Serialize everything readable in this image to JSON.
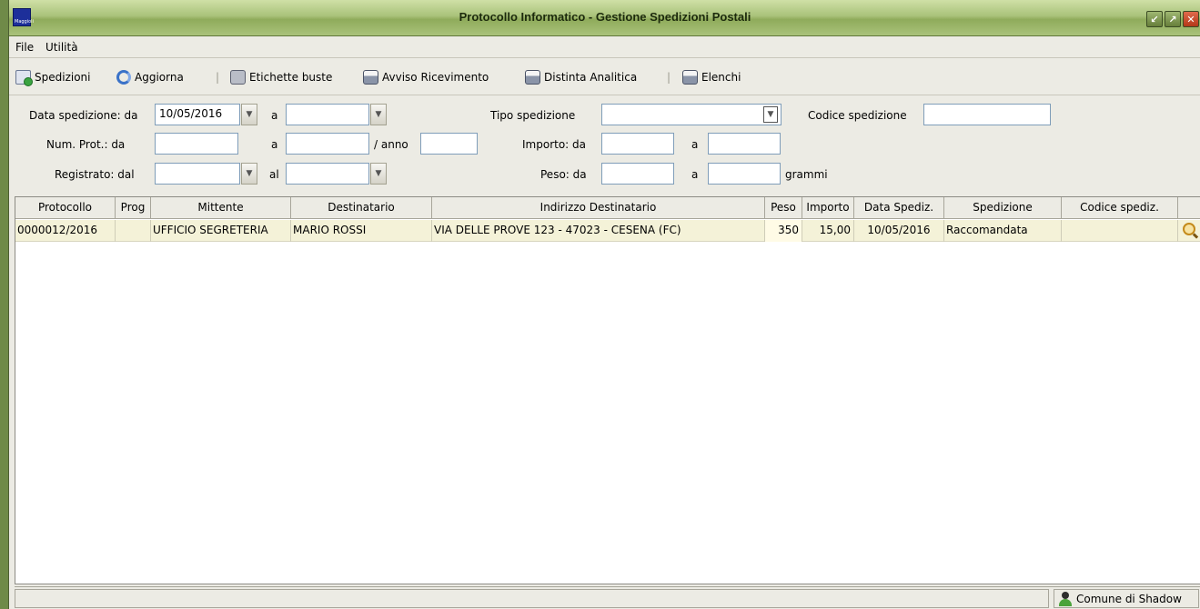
{
  "window": {
    "title": "Protocollo Informatico - Gestione Spedizioni Postali",
    "logo_text": "Maggioli"
  },
  "menu": [
    "File",
    "Utilità"
  ],
  "toolbar": {
    "spedizioni": "Spedizioni",
    "aggiorna": "Aggiorna",
    "etichette": "Etichette buste",
    "avviso": "Avviso Ricevimento",
    "distinta": "Distinta Analitica",
    "elenchi": "Elenchi"
  },
  "filters": {
    "data_spedizione_label": "Data spedizione: da",
    "data_spedizione_da": "10/05/2016",
    "a1": "a",
    "data_spedizione_a": "",
    "tipo_spedizione_label": "Tipo spedizione",
    "tipo_spedizione_value": "",
    "codice_spedizione_label": "Codice spedizione",
    "codice_spedizione_value": "",
    "num_prot_label": "Num. Prot.: da",
    "num_prot_da": "",
    "a2": "a",
    "num_prot_a": "",
    "anno_label": "/ anno",
    "anno_value": "",
    "importo_label": "Importo: da",
    "importo_da": "",
    "a3": "a",
    "importo_a": "",
    "registrato_label": "Registrato: dal",
    "registrato_dal": "",
    "al_label": "al",
    "registrato_al": "",
    "peso_label": "Peso: da",
    "peso_da": "",
    "a4": "a",
    "peso_a": "",
    "grammi_label": "grammi"
  },
  "table": {
    "headers": [
      "Protocollo",
      "Prog",
      "Mittente",
      "Destinatario",
      "Indirizzo Destinatario",
      "Peso",
      "Importo",
      "Data Spediz.",
      "Spedizione",
      "Codice spediz.",
      ""
    ],
    "rows": [
      {
        "protocollo": "0000012/2016",
        "prog": "",
        "mittente": "UFFICIO SEGRETERIA",
        "destinatario": "MARIO ROSSI",
        "indirizzo": "VIA DELLE PROVE 123 - 47023 - CESENA (FC)",
        "peso": "350",
        "importo": "15,00",
        "data": "10/05/2016",
        "spedizione": "Raccomandata",
        "codice": ""
      }
    ]
  },
  "status": {
    "user": "Comune di Shadow"
  },
  "colors": {
    "titlebar": "#a9c27a",
    "row_selected": "#f4f2d8",
    "frame": "#ecebe4"
  }
}
